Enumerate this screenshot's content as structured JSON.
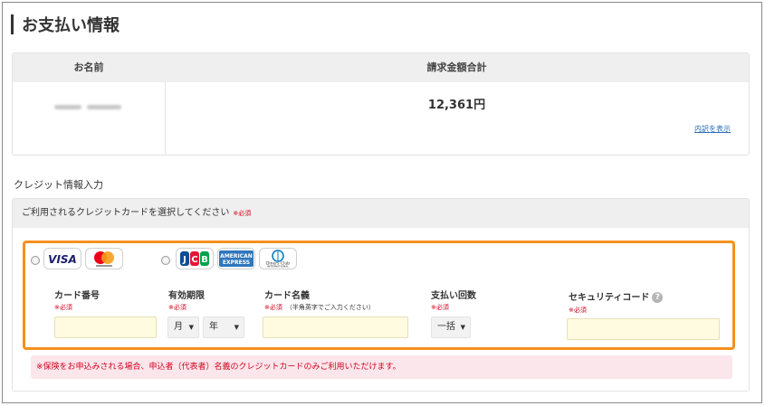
{
  "page": {
    "title": "お支払い情報"
  },
  "summary": {
    "col_name": "お名前",
    "col_total": "請求金額合計",
    "total_amount": "12,361円",
    "detail_link": "内訳を表示"
  },
  "credit": {
    "section_title": "クレジット情報入力",
    "select_prompt": "ご利用されるクレジットカードを選択してください",
    "required_mark": "※必須",
    "card_brands_group1": [
      "VISA",
      "Mastercard"
    ],
    "card_brands_group2": [
      "JCB",
      "AMERICAN EXPRESS",
      "Diners Club INTERNATIONAL"
    ],
    "fields": {
      "card_number": {
        "label": "カード番号",
        "required": "※必須"
      },
      "expiry": {
        "label": "有効期限",
        "required": "※必須",
        "month": "月",
        "year": "年"
      },
      "card_name": {
        "label": "カード名義",
        "required": "※必須",
        "note": "（半角英字でご入力ください）"
      },
      "installments": {
        "label": "支払い回数",
        "required": "※必須",
        "value": "一括"
      },
      "security_code": {
        "label": "セキュリティコード",
        "required": "※必須",
        "help": "?"
      }
    },
    "notice": "※保険をお申込みされる場合、申込者（代表者）名義のクレジットカードのみご利用いただけます。"
  },
  "colors": {
    "highlight_border": "#f5901e",
    "required": "#d0021b",
    "input_bg": "#fffbe0",
    "notice_bg": "#fbe6ec"
  }
}
